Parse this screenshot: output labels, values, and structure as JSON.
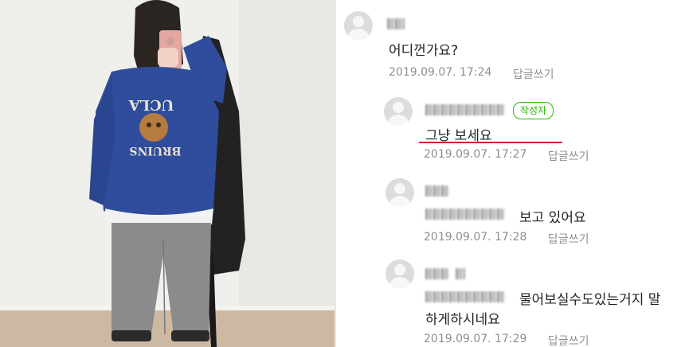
{
  "comments": [
    {
      "time": "2019.09.07. 17:24",
      "text": "어디껀가요?",
      "reply": "답글쓰기"
    },
    {
      "time": "2019.09.07. 17:27",
      "text": "그냥 보세요",
      "reply": "답글쓰기",
      "badge": "작성자"
    },
    {
      "time": "2019.09.07. 17:28",
      "text": "보고 있어요",
      "reply": "답글쓰기"
    },
    {
      "time": "2019.09.07. 17:29",
      "text": "물어보실수도있는거지 말",
      "text2": "하게하시네요",
      "reply": "답글쓰기"
    }
  ],
  "photo": {
    "sweatshirt_text_top": "UCLA",
    "sweatshirt_text_bottom": "BRUINS"
  },
  "colors": {
    "author_badge": "#2db400",
    "highlight_underline": "#e0141e",
    "sweatshirt": "#2f4d9c"
  }
}
